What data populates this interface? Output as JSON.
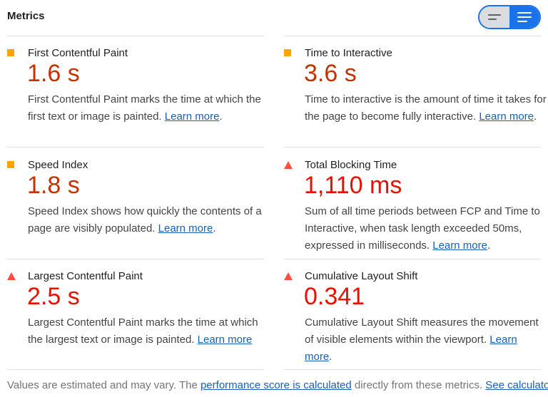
{
  "header": {
    "title": "Metrics"
  },
  "metrics": [
    {
      "title": "First Contentful Paint",
      "value": "1.6 s",
      "status": "average",
      "desc": "First Contentful Paint marks the time at which the first text or image is painted.",
      "link": "Learn more",
      "after": "."
    },
    {
      "title": "Time to Interactive",
      "value": "3.6 s",
      "status": "average",
      "desc": "Time to interactive is the amount of time it takes for the page to become fully interactive.",
      "link": "Learn more",
      "after": "."
    },
    {
      "title": "Speed Index",
      "value": "1.8 s",
      "status": "average",
      "desc": "Speed Index shows how quickly the contents of a page are visibly populated.",
      "link": "Learn more",
      "after": "."
    },
    {
      "title": "Total Blocking Time",
      "value": "1,110 ms",
      "status": "fail",
      "desc": "Sum of all time periods between FCP and Time to Interactive, when task length exceeded 50ms, expressed in milliseconds.",
      "link": "Learn more",
      "after": "."
    },
    {
      "title": "Largest Contentful Paint",
      "value": "2.5 s",
      "status": "fail",
      "desc": "Largest Contentful Paint marks the time at which the largest text or image is painted.",
      "link": "Learn more",
      "after": ""
    },
    {
      "title": "Cumulative Layout Shift",
      "value": "0.341",
      "status": "fail",
      "desc": "Cumulative Layout Shift measures the movement of visible elements within the viewport.",
      "link": "Learn more",
      "after": "."
    }
  ],
  "footer": {
    "text1": "Values are estimated and may vary. The ",
    "link1": "performance score is calculated",
    "text2": " directly from these metrics.",
    "link2": "See calculator."
  },
  "colors": {
    "average": "#ffa400",
    "fail": "#ff4e42",
    "link": "#1a5fb4",
    "accent": "#1a73e8"
  },
  "icons": {
    "average": "orange-square-icon",
    "fail": "red-triangle-icon",
    "toggle_left": "collapsed-view-icon",
    "toggle_right": "expanded-view-icon"
  }
}
